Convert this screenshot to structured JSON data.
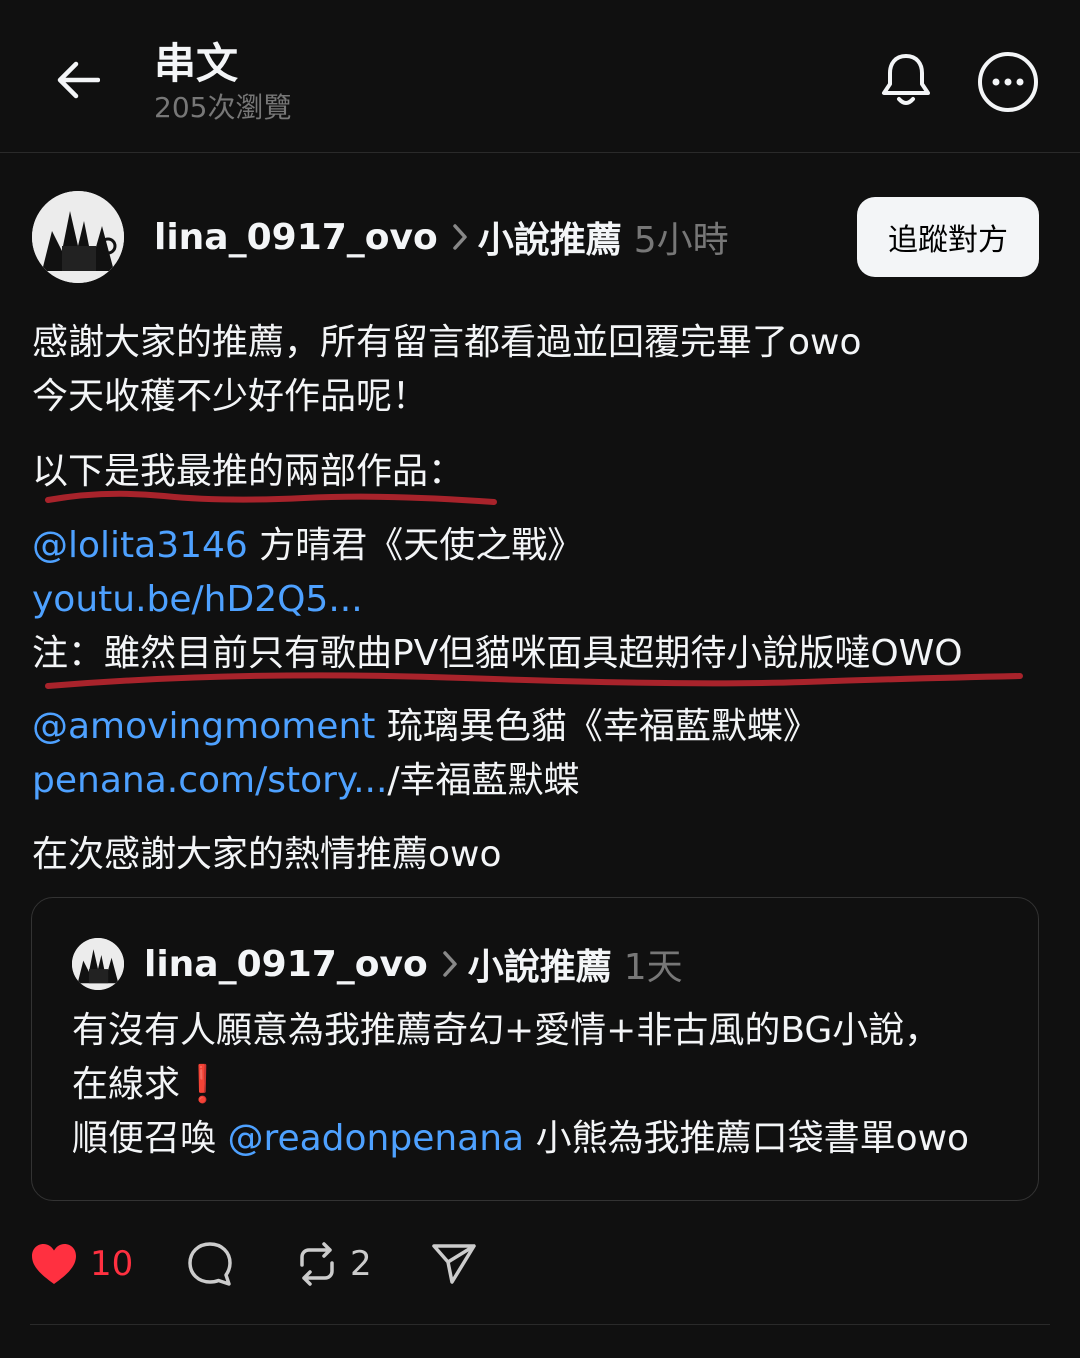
{
  "header": {
    "title": "串文",
    "views": "205次瀏覽"
  },
  "post": {
    "username": "lina_0917_ovo",
    "topic": "小說推薦",
    "time": "5小時",
    "follow_label": "追蹤對方",
    "lines": {
      "l1": "感謝大家的推薦，所有留言都看過並回覆完畢了owo",
      "l2": "今天收穫不少好作品呢！",
      "l3": "以下是我最推的兩部作品：",
      "l4_mention": "@lolita3146",
      "l4_text": " 方晴君《天使之戰》",
      "l5_link": "youtu.be/hD2Q5...",
      "l6": "注：雖然目前只有歌曲PV但貓咪面具超期待小說版噠OWO",
      "l7_mention": "@amovingmoment",
      "l7_text": " 琉璃異色貓《幸福藍默蝶》",
      "l8_link": "penana.com/story...",
      "l8_text": "/幸福藍默蝶",
      "l9": "在次感謝大家的熱情推薦owo"
    }
  },
  "quote": {
    "username": "lina_0917_ovo",
    "topic": "小說推薦",
    "time": "1天",
    "q1": "有沒有人願意為我推薦奇幻+愛情+非古風的BG小說，",
    "q2": "在線求",
    "q2_emoji": "❗",
    "q3_pre": "順便召喚 ",
    "q3_mention": "@readonpenana",
    "q3_post": " 小熊為我推薦口袋書單owo"
  },
  "actions": {
    "likes": "10",
    "reposts": "2"
  },
  "colors": {
    "background": "#101010",
    "link": "#4ea1ff",
    "like": "#ff3040",
    "underline_annotation": "#a8232b"
  },
  "icons": [
    "back-arrow-icon",
    "bell-icon",
    "more-icon",
    "chevron-right-icon",
    "heart-icon",
    "comment-icon",
    "repost-icon",
    "share-icon"
  ]
}
